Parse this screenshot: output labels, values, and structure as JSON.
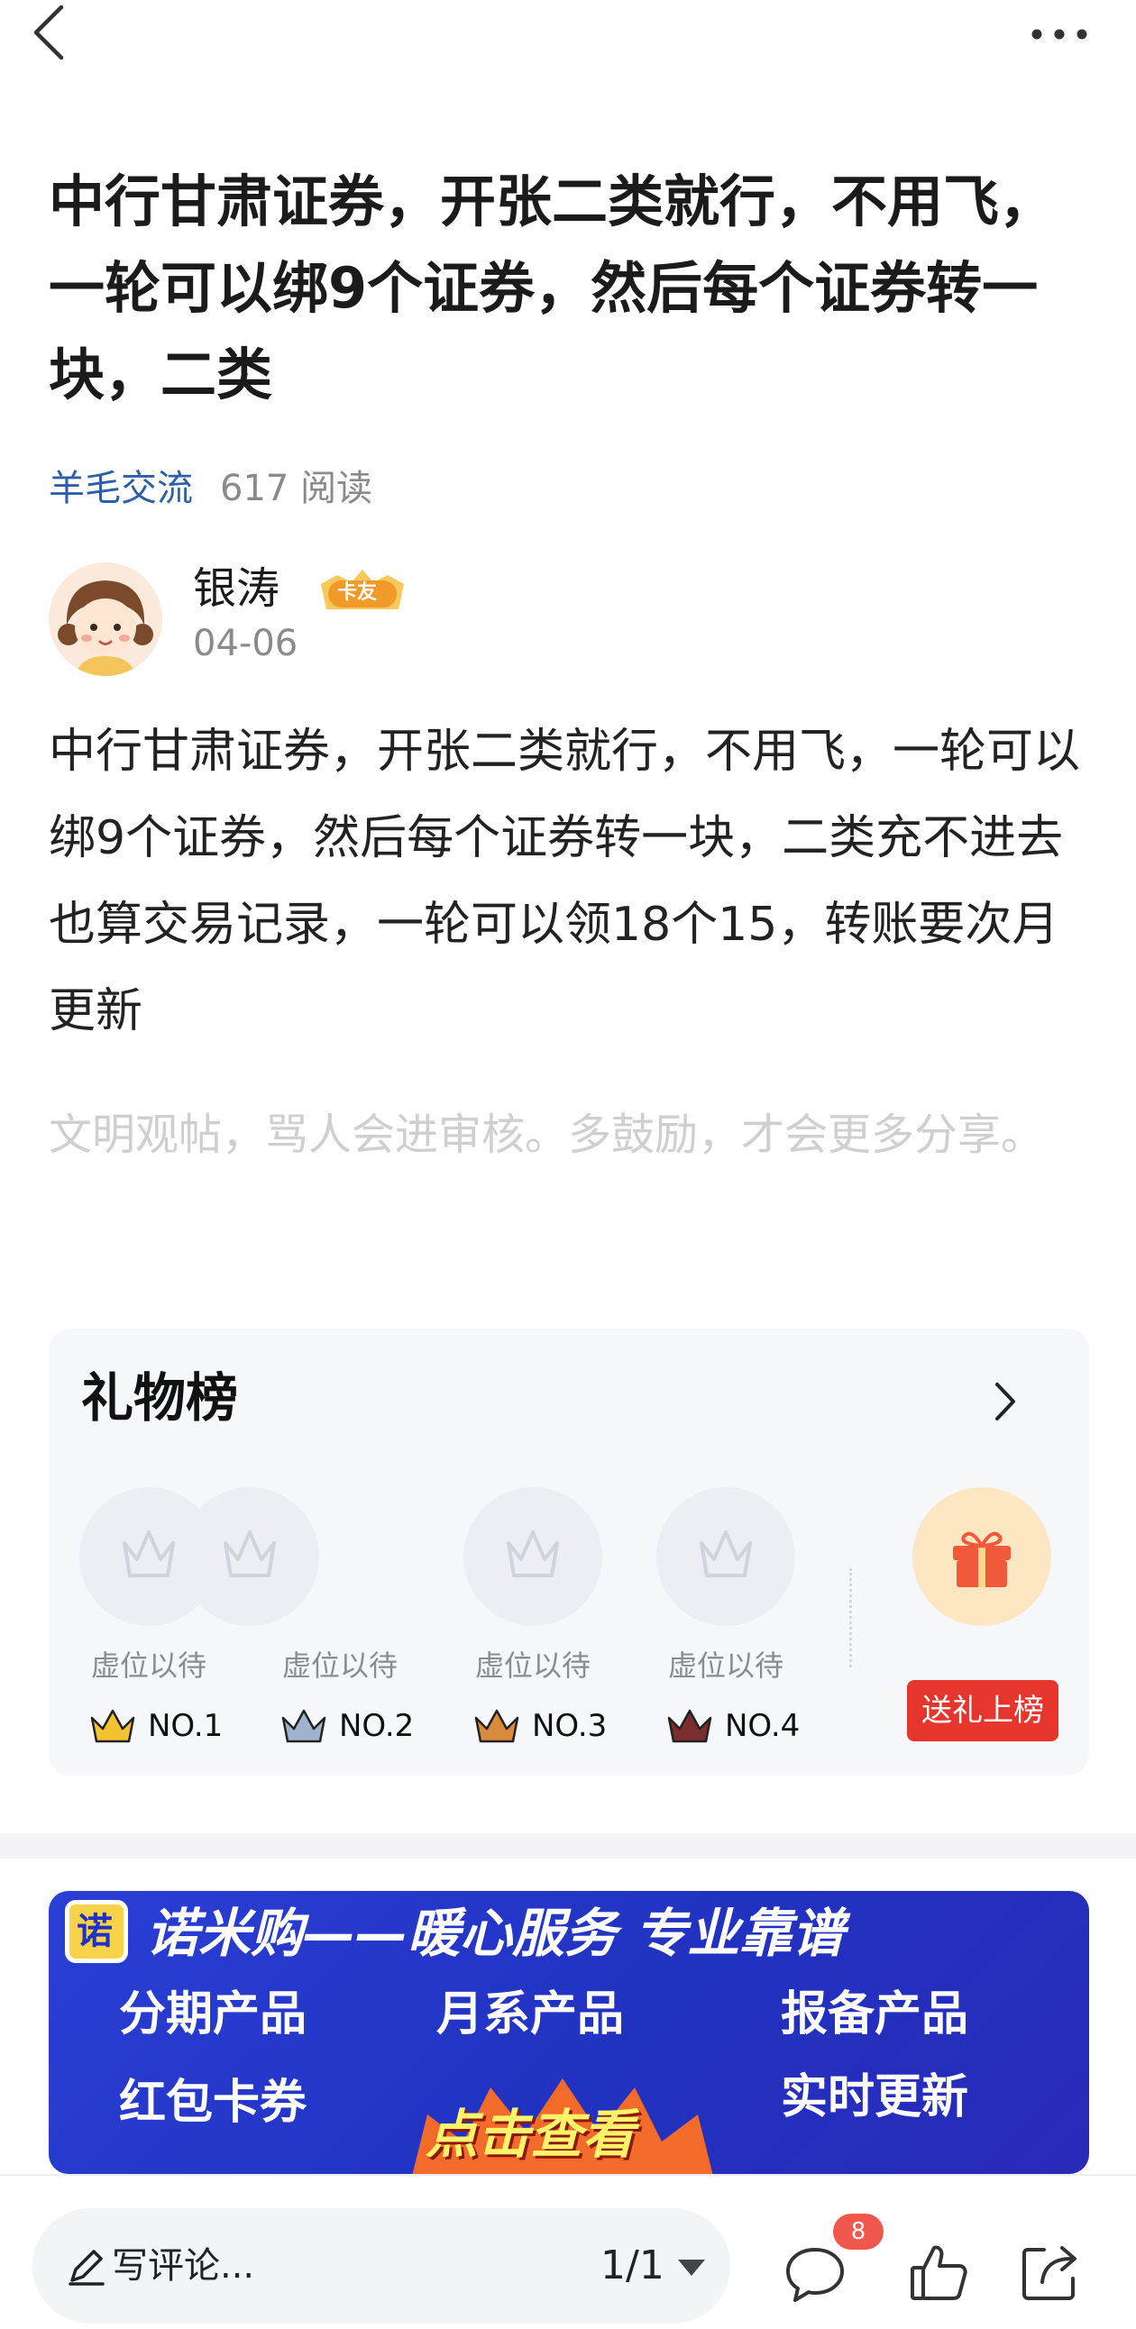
{
  "post": {
    "title": "中行甘肃证券，开张二类就行，不用飞，一轮可以绑9个证券，然后每个证券转一块，二类",
    "category": "羊毛交流",
    "read_count": "617 阅读",
    "author": {
      "name": "银涛",
      "badge": "卡友",
      "date": "04-06"
    },
    "body": "中行甘肃证券，开张二类就行，不用飞，一轮可以绑9个证券，然后每个证券转一块，二类充不进去也算交易记录，一轮可以领18个15，转账要次月更新",
    "notice": "文明观帖，骂人会进审核。多鼓励，才会更多分享。"
  },
  "gift_board": {
    "title": "礼物榜",
    "slots": [
      {
        "label": "虚位以待",
        "rank": "NO.1",
        "crown_color": "#f2c230"
      },
      {
        "label": "虚位以待",
        "rank": "NO.2",
        "crown_color": "#9fb4cc"
      },
      {
        "label": "虚位以待",
        "rank": "NO.3",
        "crown_color": "#d98a3c"
      },
      {
        "label": "虚位以待",
        "rank": "NO.4",
        "crown_color": "#7a2e2e"
      }
    ],
    "send_button": "送礼上榜"
  },
  "ad": {
    "logo": "诺",
    "headline": "诺米购——暖心服务 专业靠谱",
    "items": [
      "分期产品",
      "月系产品",
      "报备产品",
      "红包卡券",
      "实时更新"
    ],
    "cta": "点击查看"
  },
  "bottom_bar": {
    "comment_placeholder": "写评论...",
    "page_indicator": "1/1",
    "comment_count": "8"
  },
  "colors": {
    "accent_link": "#2d5fa8",
    "gift_button": "#e5352c",
    "ad_background": "#2132c0",
    "badge_red": "#f0574d"
  }
}
